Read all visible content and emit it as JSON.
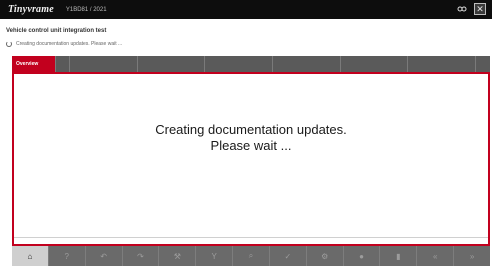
{
  "titlebar": {
    "logo": "Tinyvrame",
    "version": "Y1BD81 / 2021",
    "icons": [
      "goggles-icon",
      "close-icon"
    ]
  },
  "header": {
    "title": "Vehicle control unit integration test",
    "status": "Creating documentation updates. Please wait ..."
  },
  "tabs": [
    {
      "label": "Overview",
      "active": true
    },
    {
      "label": "",
      "active": false
    },
    {
      "label": "",
      "active": false
    },
    {
      "label": "",
      "active": false
    },
    {
      "label": "",
      "active": false
    },
    {
      "label": "",
      "active": false
    },
    {
      "label": "",
      "active": false
    },
    {
      "label": "",
      "active": false
    },
    {
      "label": "",
      "active": false
    }
  ],
  "main": {
    "message_line1": "Creating documentation updates.",
    "message_line2": "Please wait ..."
  },
  "toolbar": {
    "active_label": "",
    "buttons": [
      "home-icon",
      "help-icon",
      "back-icon",
      "forward-icon",
      "tools-icon",
      "filter-icon",
      "search-icon",
      "check-icon",
      "settings-icon",
      "record-icon",
      "print-icon",
      "prev-icon",
      "next-icon"
    ]
  },
  "colors": {
    "accent": "#c2001e",
    "titlebar": "#0d0d0d",
    "tabbar": "#5a5a5a",
    "toolbar": "#6a6a6a"
  }
}
